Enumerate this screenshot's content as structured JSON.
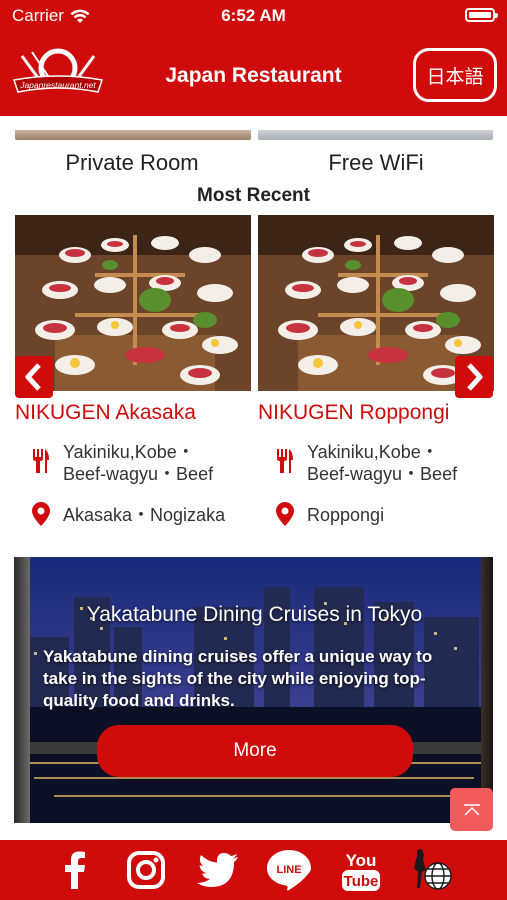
{
  "status_bar": {
    "carrier": "Carrier",
    "time": "6:52 AM"
  },
  "header": {
    "title": "Japan Restaurant",
    "language_button": "日本語",
    "logo_text": "Japanrestaurant.net"
  },
  "features": [
    {
      "label": "Private Room"
    },
    {
      "label": "Free WiFi"
    }
  ],
  "most_recent": {
    "title": "Most Recent",
    "restaurants": [
      {
        "name": "NIKUGEN Akasaka",
        "cuisine_line1": "Yakiniku,Kobe・",
        "cuisine_line2": "Beef-wagyu・Beef",
        "location": "Akasaka・Nogizaka"
      },
      {
        "name": "NIKUGEN Roppongi",
        "cuisine_line1": "Yakiniku,Kobe・",
        "cuisine_line2": "Beef-wagyu・Beef",
        "location": "Roppongi"
      }
    ]
  },
  "banner": {
    "title": "Yakatabune Dining Cruises in Tokyo",
    "description": "Yakatabune dining cruises offer a unique way to take in the sights of the city while enjoying top-quality food and drinks.",
    "button": "More"
  },
  "footer": {
    "social": [
      {
        "icon": "facebook-icon"
      },
      {
        "icon": "instagram-icon"
      },
      {
        "icon": "twitter-icon"
      },
      {
        "icon": "line-icon",
        "text": "LINE"
      },
      {
        "icon": "youtube-icon",
        "text_top": "You",
        "text_bottom": "Tube"
      },
      {
        "icon": "globe-icon"
      }
    ]
  },
  "colors": {
    "brand_red": "#d00b0b",
    "scroll_top_button": "#f15b5b",
    "text_dark": "#222222"
  }
}
